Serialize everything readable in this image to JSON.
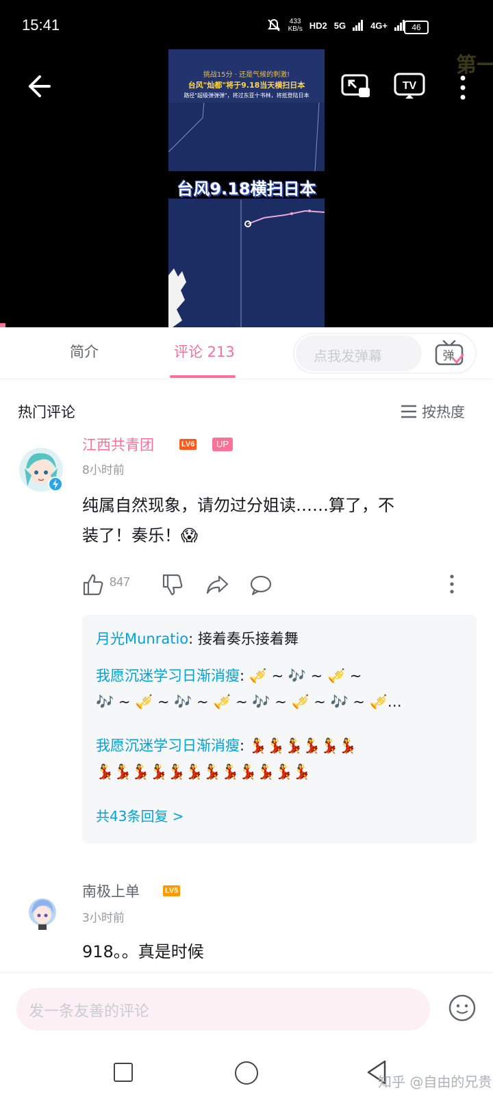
{
  "status_bar": {
    "time": "15:41",
    "net_speed_value": "433",
    "net_speed_unit": "KB/s",
    "hd_badge": "HD2",
    "signal_5g": "5G",
    "signal_4g": "4G+",
    "battery": "46"
  },
  "video": {
    "corner_text": "第一",
    "frame_line1": "挑战15分 · 还是气候的刺激!",
    "frame_line2": "台风\"灿都\"将于9.18当天横扫日本",
    "frame_line3": "路径\"超级弹弹弹\"，将过东亚十书林，将抵登陆日本",
    "frame_title": "台风9.18横扫日本"
  },
  "tabs": {
    "intro": "简介",
    "comments": "评论 213",
    "danmaku_placeholder": "点我发弹幕",
    "danmaku_button": "弹"
  },
  "hot_comments": {
    "heading": "热门评论",
    "sort_label": "按热度"
  },
  "comments": [
    {
      "username": "江西共青团",
      "level": "LV6",
      "up_badge": "UP",
      "time": "8小时前",
      "text_line1": "纯属自然现象，请勿过分姐读……算了，不",
      "text_line2": "装了！奏乐！😱",
      "like_count": "847",
      "replies": [
        {
          "name": "月光Munratio",
          "text": ": 接着奏乐接着舞"
        },
        {
          "name": "我愿沉迷学习日渐消瘦",
          "text": ": 🎺 ~ 🎶 ~ 🎺 ~",
          "text_cont": "🎶 ~ 🎺 ~ 🎶 ~ 🎺 ~ 🎶 ~ 🎺 ~ 🎶 ~ 🎺…"
        },
        {
          "name": "我愿沉迷学习日渐消瘦",
          "text": ": 💃💃💃💃💃💃",
          "text_cont": "💃💃💃💃💃💃💃💃💃💃💃💃"
        }
      ],
      "reply_more": "共43条回复 >"
    },
    {
      "username": "南极上单",
      "level": "LV5",
      "time": "3小时前",
      "text_line1": "918。。真是时候"
    }
  ],
  "comment_input": {
    "placeholder": "发一条友善的评论"
  },
  "watermark": "知乎 @自由的兄贵",
  "colors": {
    "accent": "#fb7299",
    "link": "#00a1d6",
    "level6": "#ff5a1f",
    "level5": "#ff9a00"
  }
}
